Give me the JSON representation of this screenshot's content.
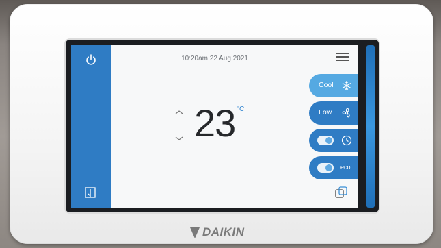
{
  "header": {
    "datetime": "10:20am 22 Aug 2021"
  },
  "temperature": {
    "value": "23",
    "unit": "°C"
  },
  "controls": [
    {
      "label": "Cool",
      "icon": "snowflake-icon"
    },
    {
      "label": "Low",
      "icon": "fan-icon"
    },
    {
      "label": "",
      "icon": "clock-icon",
      "toggle": "on"
    },
    {
      "label": "eco",
      "toggle": "on"
    }
  ],
  "brand": {
    "name": "DAIKIN"
  },
  "colors": {
    "sidebar": "#2f7cc4",
    "accent": "#2d82cf",
    "pill_light": "#55a9e2",
    "screen_bg": "#f7f8f9"
  }
}
